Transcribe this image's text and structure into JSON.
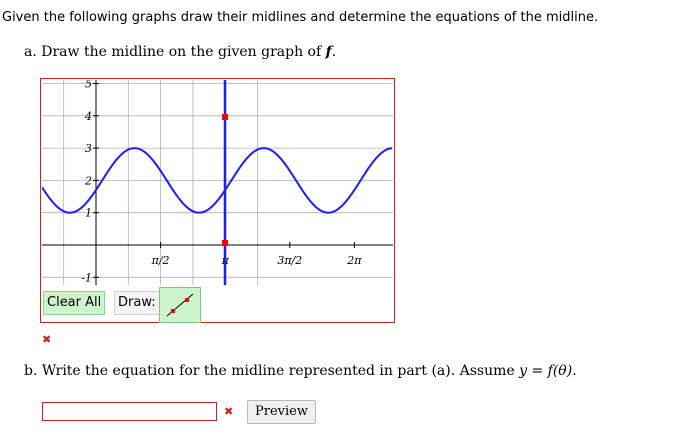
{
  "question": {
    "intro": "Given the following graphs draw their midlines and determine the equations of the midline.",
    "part_a": {
      "text": "a. Draw the midline on the given graph of ",
      "var": "f",
      "suffix": "."
    },
    "part_b": {
      "text": "b. Write the equation for the midline represented in part (a). Assume ",
      "math": "y = f(θ)",
      "suffix": "."
    }
  },
  "graph": {
    "y_ticks": [
      "5",
      "4",
      "3",
      "2",
      "1",
      "-1"
    ],
    "x_ticks": [
      "π/2",
      "π",
      "3π/2",
      "2π"
    ],
    "colors": {
      "grid": "#b0b0b0",
      "axis": "#000000",
      "curve": "#1c1cff",
      "drawn_line": "#1c1cff",
      "point": "#ff0000"
    }
  },
  "tools": {
    "clear_label": "Clear All",
    "draw_label": "Draw:",
    "draw_tool_icon": "line-segment-icon"
  },
  "answer": {
    "value": "",
    "placeholder": "",
    "preview_label": "Preview"
  },
  "feedback": {
    "mark": "✖"
  }
}
